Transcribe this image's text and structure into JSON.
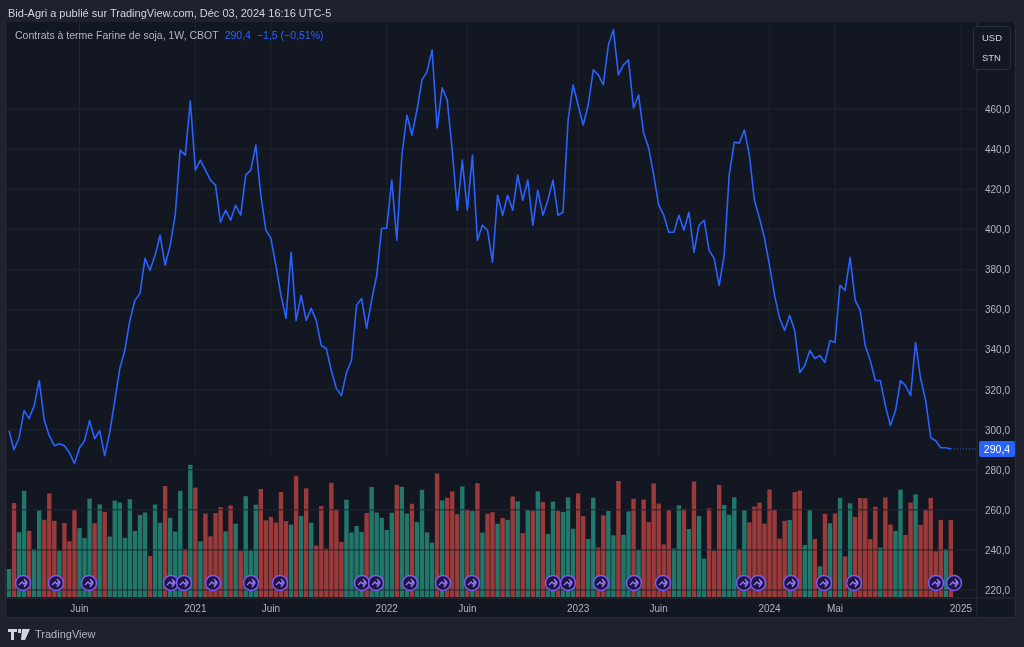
{
  "header": {
    "text": "Bid-Agri a publié sur TradingView.com, Déc 03, 2024 16:16 UTC-5"
  },
  "legend": {
    "symbol": "Contrats à terme Farine de soja, 1W, CBOT",
    "price": "290,4",
    "change": "−1,5 (−0,51%)"
  },
  "currency_menu": [
    "USD",
    "STN"
  ],
  "chart": {
    "last_price_label": "290,4",
    "chart_data": {
      "type": "line",
      "grid": true,
      "categories": [
        null,
        null,
        null,
        null,
        null,
        null,
        null,
        null,
        null,
        null,
        null,
        null,
        null,
        null,
        "Juin",
        null,
        null,
        null,
        null,
        null,
        null,
        null,
        null,
        null,
        null,
        null,
        null,
        null,
        null,
        null,
        null,
        null,
        null,
        null,
        null,
        null,
        null,
        "2021",
        null,
        null,
        null,
        null,
        null,
        null,
        null,
        null,
        null,
        null,
        null,
        null,
        null,
        null,
        "Juin",
        null,
        null,
        null,
        null,
        null,
        null,
        null,
        null,
        null,
        null,
        null,
        null,
        null,
        null,
        null,
        null,
        null,
        null,
        null,
        null,
        null,
        null,
        "2022",
        null,
        null,
        null,
        null,
        null,
        null,
        null,
        null,
        null,
        null,
        null,
        null,
        null,
        null,
        null,
        "Juin",
        null,
        null,
        null,
        null,
        null,
        null,
        null,
        null,
        null,
        null,
        null,
        null,
        null,
        null,
        null,
        null,
        null,
        null,
        null,
        null,
        null,
        "2023",
        null,
        null,
        null,
        null,
        null,
        null,
        null,
        null,
        null,
        null,
        null,
        null,
        null,
        null,
        null,
        "Juin",
        null,
        null,
        null,
        null,
        null,
        null,
        null,
        null,
        null,
        null,
        null,
        null,
        null,
        null,
        null,
        null,
        null,
        null,
        null,
        null,
        null,
        "2024",
        null,
        null,
        null,
        null,
        null,
        null,
        null,
        null,
        null,
        null,
        null,
        null,
        "Mai",
        null,
        null,
        null,
        null,
        null,
        null,
        null,
        null,
        null,
        null,
        null,
        null,
        null,
        null,
        null,
        null,
        null,
        null,
        null,
        null,
        null,
        null,
        null,
        null,
        "2025"
      ],
      "series": [
        {
          "color": "#2962ff",
          "values": [
            299.5,
            290,
            296,
            309.5,
            305.5,
            312,
            324.5,
            304.5,
            297,
            292,
            293,
            292,
            288.5,
            283,
            291,
            294.5,
            304.5,
            295.5,
            299.5,
            287,
            298.5,
            314.5,
            330.5,
            339.5,
            354.5,
            364.5,
            368,
            385.5,
            379.5,
            387,
            397,
            382,
            392,
            407,
            439.5,
            437,
            464,
            429.5,
            434.5,
            429.5,
            424.5,
            422,
            403.5,
            409.5,
            404.5,
            412,
            407,
            427,
            429.5,
            442,
            417,
            399.5,
            395.5,
            382,
            367,
            355.5,
            388.5,
            354.5,
            367,
            354.5,
            360.5,
            354.5,
            342,
            340.5,
            329.5,
            320.5,
            317,
            328.5,
            334.5,
            362,
            365.5,
            350.5,
            364.5,
            377,
            400.5,
            400.5,
            424.5,
            394.5,
            437,
            457,
            447,
            459.5,
            474.5,
            478.5,
            489.5,
            450.5,
            470.5,
            464.5,
            439.5,
            409.5,
            434.5,
            409.5,
            437,
            394.5,
            402,
            399.5,
            383.5,
            417,
            407,
            417,
            409.5,
            427,
            414.5,
            424.5,
            402,
            419.5,
            407,
            414.5,
            424.5,
            407,
            408.5,
            454.5,
            472,
            462,
            452,
            462,
            479.5,
            477,
            472,
            492,
            499.5,
            477,
            482,
            484.5,
            460.5,
            467,
            448,
            440.5,
            427,
            412,
            407,
            398.5,
            398.5,
            407,
            399.5,
            408.5,
            388.5,
            402,
            404.5,
            389.5,
            385.5,
            372,
            387,
            427,
            443.5,
            443,
            449.5,
            437,
            414.5,
            405.5,
            395.5,
            382,
            367,
            355.5,
            349.5,
            357,
            349.5,
            328.5,
            332,
            339.5,
            335.5,
            337,
            333.5,
            344.5,
            343.5,
            372,
            369.5,
            386,
            364.5,
            359.5,
            342,
            334.5,
            324.5,
            324.5,
            312,
            302,
            309.5,
            324.5,
            322,
            317,
            343.5,
            325.5,
            314.5,
            296,
            294.5,
            291,
            291,
            290.4,
            null,
            null
          ]
        }
      ],
      "ylim": [
        216.5,
        503.4
      ],
      "yticks": [
        {
          "value": 220,
          "label": "220,0"
        },
        {
          "value": 240,
          "label": "240,0"
        },
        {
          "value": 260,
          "label": "260,0"
        },
        {
          "value": 280,
          "label": "280,0"
        },
        {
          "value": 300,
          "label": "300,0"
        },
        {
          "value": 320,
          "label": "320,0"
        },
        {
          "value": 340,
          "label": "340,0"
        },
        {
          "value": 360,
          "label": "360,0"
        },
        {
          "value": 380,
          "label": "380,0"
        },
        {
          "value": 400,
          "label": "400,0"
        },
        {
          "value": 420,
          "label": "420,0"
        },
        {
          "value": 440,
          "label": "440,0"
        },
        {
          "value": 460,
          "label": "460,0"
        }
      ]
    }
  },
  "footer": {
    "brand": "TradingView"
  }
}
